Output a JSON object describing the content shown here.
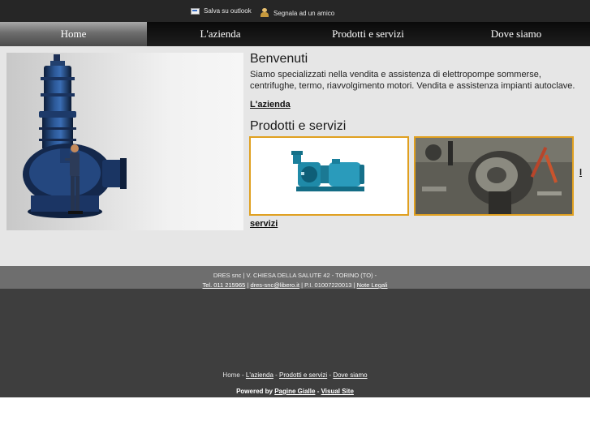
{
  "topbar": {
    "save_outlook": "Salva su outlook",
    "recommend": "Segnala ad un amico",
    "save_icon": "mail-icon",
    "recommend_icon": "person-icon"
  },
  "nav": {
    "items": [
      {
        "label": "Home",
        "active": true
      },
      {
        "label": "L'azienda",
        "active": false
      },
      {
        "label": "Prodotti e servizi",
        "active": false
      },
      {
        "label": "Dove siamo",
        "active": false
      }
    ]
  },
  "main": {
    "welcome_title": "Benvenuti",
    "welcome_text": "Siamo specializzati nella vendita e assistenza di elettropompe sommerse, centrifughe, termo, riavvolgimento motori. Vendita e assistenza impianti autoclave.",
    "azienda_link": "L'azienda",
    "products_title": "Prodotti e servizi",
    "products_link_fragment": "l",
    "servizi_link": "servizi"
  },
  "footer": {
    "company": "DRES snc | V. CHIESA DELLA SALUTE 42 - TORINO (TO) -",
    "phone": "Tel. 011 215965",
    "email": "dres-snc@libero.it",
    "vat": "P.I. 01007220013",
    "legal": "Note Legali",
    "sep": "|"
  },
  "bottom_nav": {
    "home": "Home",
    "azienda": "L'azienda",
    "prodotti": "Prodotti e servizi",
    "dove": "Dove siamo",
    "sep": "-"
  },
  "powered": {
    "label": "Powered by",
    "pagine": "Pagine Gialle",
    "sep": "-",
    "visual": "Visual Site"
  },
  "colors": {
    "accent_border": "#e0a020",
    "nav_bg": "#111111",
    "footer_bg": "#6e6e6e"
  }
}
